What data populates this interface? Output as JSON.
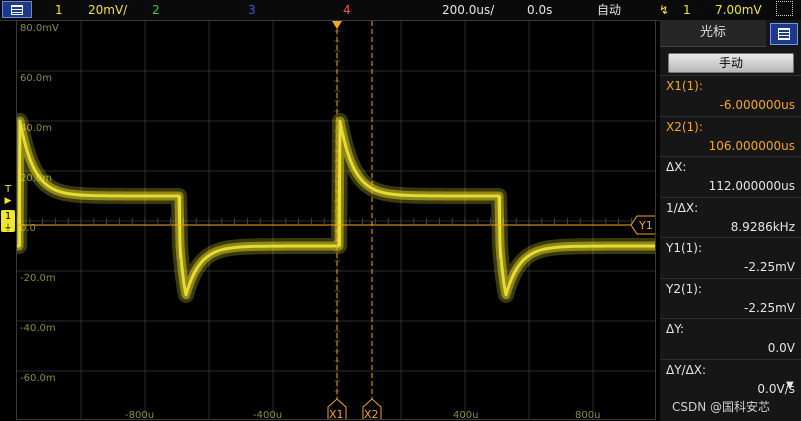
{
  "topbar": {
    "ch1_num": "1",
    "ch1_scale": "20mV/",
    "ch2_num": "2",
    "ch3_num": "3",
    "ch4_num": "4",
    "timebase": "200.0us/",
    "delay": "0.0s",
    "trigger_mode": "自动",
    "trigger_source": "1",
    "trigger_level": "7.00mV"
  },
  "colors": {
    "ch1": "#f0e630",
    "ch2": "#2ecc40",
    "ch3": "#3b5bdb",
    "ch4": "#ff4d4d",
    "cursor": "#f5a623"
  },
  "screen": {
    "y_labels": [
      "80.0mV",
      "60.0m",
      "40.0m",
      "20.0m",
      "0.0",
      "-20.0m",
      "-40.0m",
      "-60.0m"
    ],
    "x_labels": [
      "-800u",
      "-400u",
      "400u",
      "800u"
    ],
    "cursor_x1_label": "X1",
    "cursor_x2_label": "X2",
    "cursor_y1_label": "Y1"
  },
  "left_markers": {
    "trigger": "T",
    "channel": "1"
  },
  "panel": {
    "title": "光标",
    "mode": "手动",
    "rows": [
      {
        "label": "X1(1):",
        "value": "-6.000000us",
        "color": "orange"
      },
      {
        "label": "X2(1):",
        "value": "106.000000us",
        "color": "orange"
      },
      {
        "label": "ΔX:",
        "value": "112.000000us",
        "color": "white"
      },
      {
        "label": "1/ΔX:",
        "value": "8.9286kHz",
        "color": "white"
      },
      {
        "label": "Y1(1):",
        "value": "-2.25mV",
        "color": "white"
      },
      {
        "label": "Y2(1):",
        "value": "-2.25mV",
        "color": "white"
      },
      {
        "label": "ΔY:",
        "value": "0.0V",
        "color": "white"
      },
      {
        "label": "ΔY/ΔX:",
        "value": "0.0V/s",
        "color": "white"
      }
    ]
  },
  "watermark": "CSDN @国科安芯"
}
